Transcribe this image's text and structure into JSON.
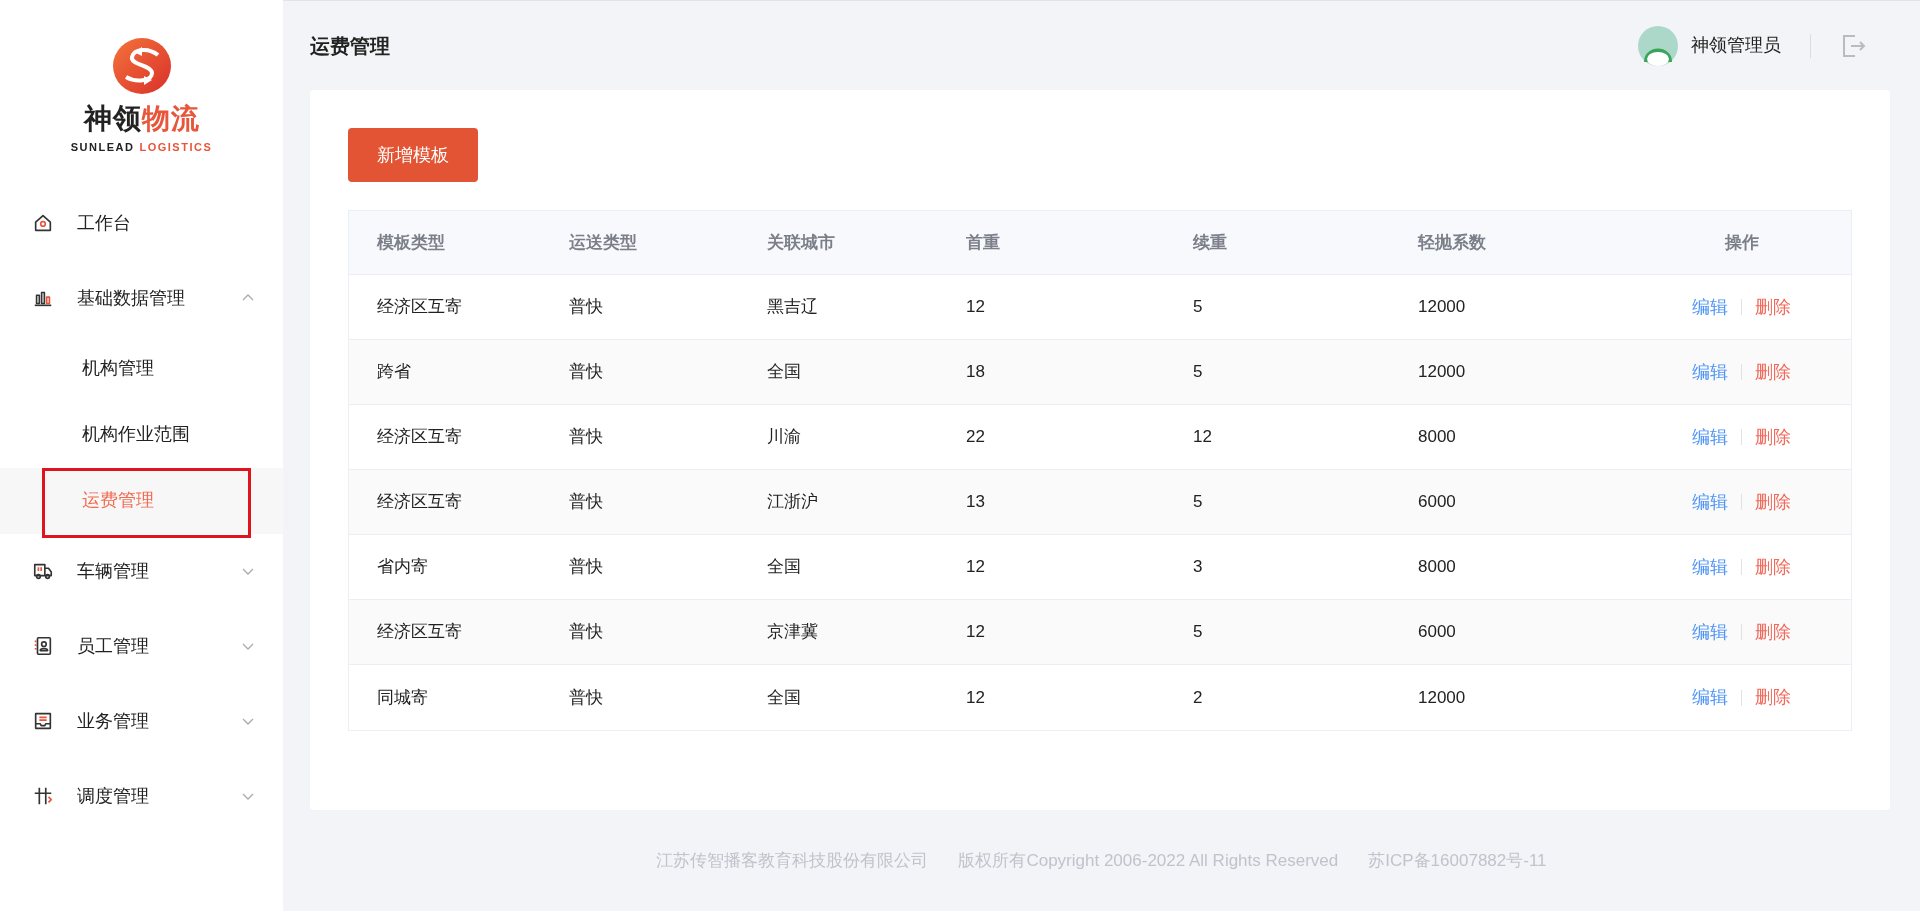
{
  "logo": {
    "name_dark": "神领",
    "name_accent": "物流",
    "sub_dark": "SUNLEAD",
    "sub_accent": "LOGISTICS"
  },
  "sidebar": {
    "items": [
      {
        "label": "工作台",
        "kind": "link",
        "selected": false
      },
      {
        "label": "基础数据管理",
        "kind": "group",
        "expanded": true,
        "children": [
          {
            "label": "机构管理",
            "selected": false
          },
          {
            "label": "机构作业范围",
            "selected": false
          },
          {
            "label": "运费管理",
            "selected": true
          }
        ]
      },
      {
        "label": "车辆管理",
        "kind": "group",
        "expanded": false
      },
      {
        "label": "员工管理",
        "kind": "group",
        "expanded": false
      },
      {
        "label": "业务管理",
        "kind": "group",
        "expanded": false
      },
      {
        "label": "调度管理",
        "kind": "group",
        "expanded": false
      }
    ]
  },
  "header": {
    "title": "运费管理",
    "user": "神领管理员"
  },
  "add_button": "新增模板",
  "table": {
    "columns": [
      "模板类型",
      "运送类型",
      "关联城市",
      "首重",
      "续重",
      "轻抛系数",
      "操作"
    ],
    "rows": [
      {
        "cells": [
          "经济区互寄",
          "普快",
          "黑吉辽",
          "12",
          "5",
          "12000"
        ],
        "actions": [
          "编辑",
          "删除"
        ]
      },
      {
        "cells": [
          "跨省",
          "普快",
          "全国",
          "18",
          "5",
          "12000"
        ],
        "actions": [
          "编辑",
          "删除"
        ]
      },
      {
        "cells": [
          "经济区互寄",
          "普快",
          "川渝",
          "22",
          "12",
          "8000"
        ],
        "actions": [
          "编辑",
          "删除"
        ]
      },
      {
        "cells": [
          "经济区互寄",
          "普快",
          "江浙沪",
          "13",
          "5",
          "6000"
        ],
        "actions": [
          "编辑",
          "删除"
        ]
      },
      {
        "cells": [
          "省内寄",
          "普快",
          "全国",
          "12",
          "3",
          "8000"
        ],
        "actions": [
          "编辑",
          "删除"
        ]
      },
      {
        "cells": [
          "经济区互寄",
          "普快",
          "京津冀",
          "12",
          "5",
          "6000"
        ],
        "actions": [
          "编辑",
          "删除"
        ]
      },
      {
        "cells": [
          "同城寄",
          "普快",
          "全国",
          "12",
          "2",
          "12000"
        ],
        "actions": [
          "编辑",
          "删除"
        ]
      }
    ]
  },
  "footer": [
    "江苏传智播客教育科技股份有限公司",
    "版权所有Copyright 2006-2022 All Rights Reserved",
    "苏ICP备16007882号-11"
  ]
}
